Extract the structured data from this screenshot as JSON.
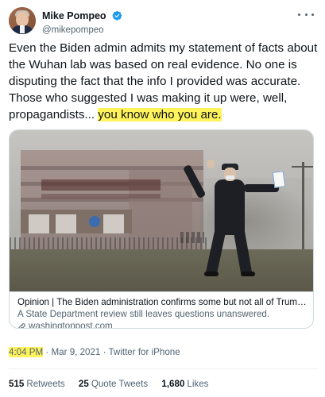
{
  "author": {
    "display_name": "Mike Pompeo",
    "handle": "@mikepompeo",
    "verified_icon": "verified-badge-icon",
    "verified_color": "#1d9bf0"
  },
  "tweet": {
    "text_main": "Even the Biden admin admits my statement of facts about the Wuhan lab was based on real evidence. No one is disputing the fact that the info I provided was accurate. Those who suggested I was making it up were, well, propagandists... ",
    "text_highlight": "you know who you are.",
    "highlight_color": "#fff35c"
  },
  "card": {
    "title": "Opinion | The Biden administration confirms some but not all of Trump's Wuhan...",
    "description": "A State Department review still leaves questions unanswered.",
    "domain": "washingtonpost.com",
    "link_icon": "link-icon"
  },
  "meta": {
    "time": "4:04 PM",
    "separator1": " · ",
    "date": "Mar 9, 2021",
    "separator2": " · ",
    "source": "Twitter for iPhone"
  },
  "stats": {
    "retweets_count": "515",
    "retweets_label": "Retweets",
    "quotes_count": "25",
    "quotes_label": "Quote Tweets",
    "likes_count": "1,680",
    "likes_label": "Likes"
  },
  "more_icon": "more-options-icon"
}
